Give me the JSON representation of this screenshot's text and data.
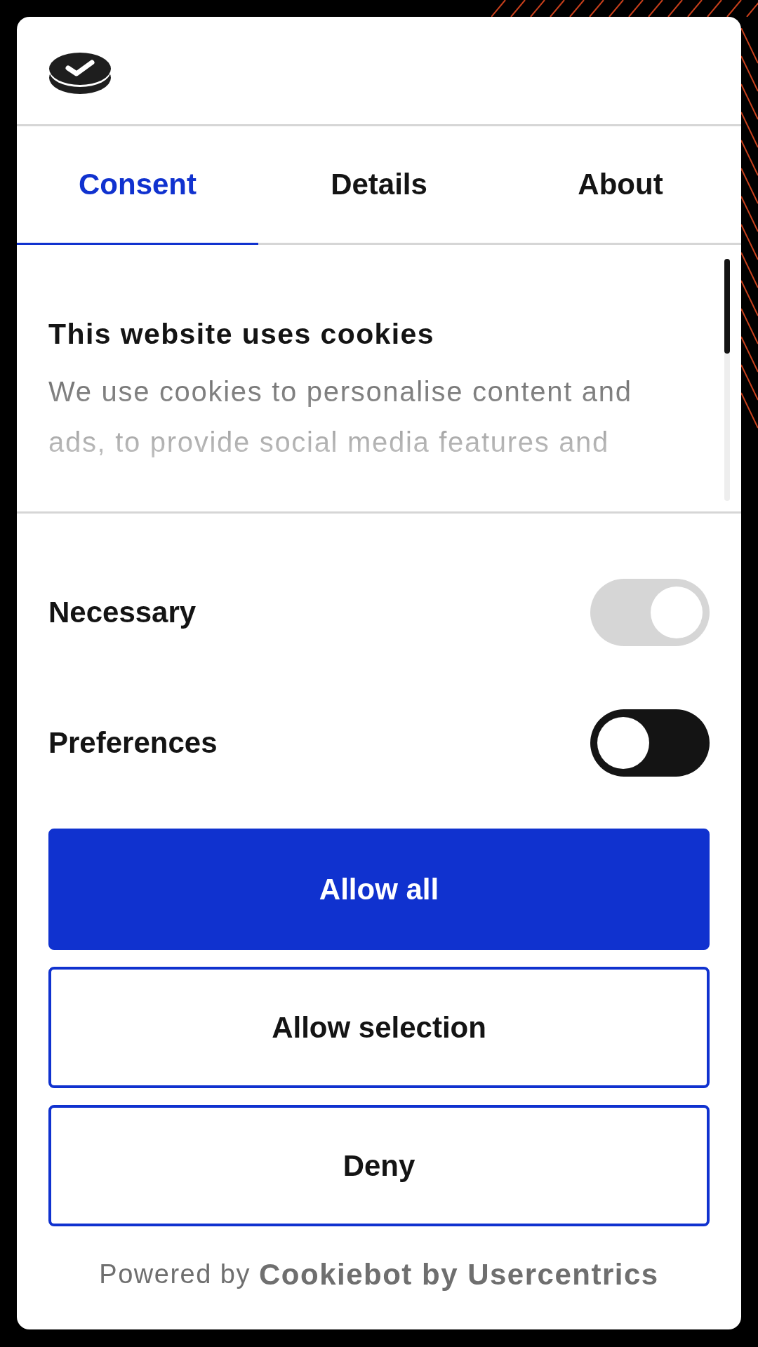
{
  "tabs": [
    {
      "label": "Consent",
      "selected": true
    },
    {
      "label": "Details",
      "selected": false
    },
    {
      "label": "About",
      "selected": false
    }
  ],
  "content": {
    "heading": "This website uses cookies",
    "body": "We use cookies to personalise content and ads, to provide social media features and"
  },
  "toggles": [
    {
      "label": "Necessary",
      "on": true,
      "disabled": true
    },
    {
      "label": "Preferences",
      "on": false,
      "disabled": false
    }
  ],
  "buttons": [
    {
      "label": "Allow all",
      "kind": "primary"
    },
    {
      "label": "Allow selection",
      "kind": "outline"
    },
    {
      "label": "Deny",
      "kind": "outline"
    }
  ],
  "footer": {
    "prefix": "Powered by",
    "brand": "Cookiebot by Usercentrics"
  }
}
